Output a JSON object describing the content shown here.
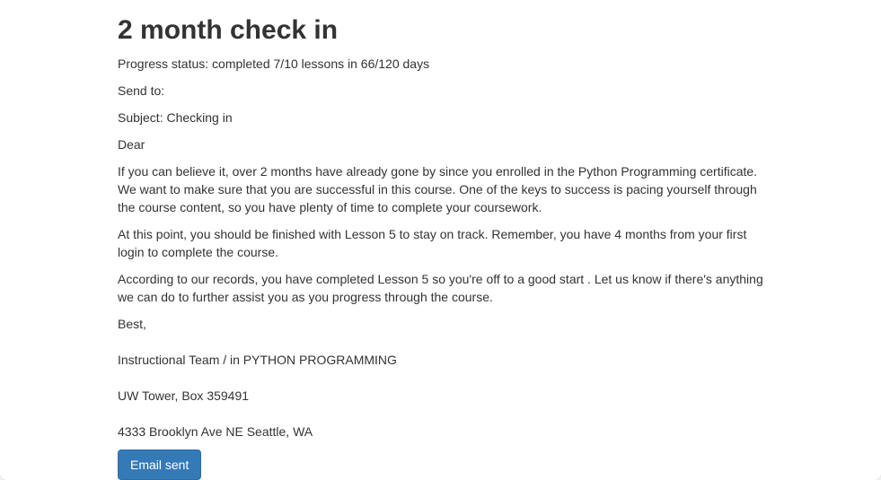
{
  "title": "2 month check in",
  "progress_status": "Progress status: completed 7/10 lessons in 66/120 days",
  "send_to": "Send to:",
  "subject": "Subject: Checking in",
  "greeting": "Dear",
  "paragraphs": [
    "If you can believe it, over 2 months have already gone by since you enrolled in the Python Programming certificate. We want to make sure that you are successful in this course. One of the keys to success is pacing yourself through the course content, so you have plenty of time to complete your coursework.",
    "At this point, you should be finished with Lesson 5 to stay on track. Remember, you have 4 months from your first login to complete the course.",
    "According to our records, you have completed Lesson 5 so you're off to a good start . Let us know if there's anything we can do to further assist you as you progress through the course."
  ],
  "signoff": "Best,",
  "signature": {
    "team": "Instructional Team / in PYTHON PROGRAMMING",
    "address_line1": "UW Tower, Box 359491",
    "address_line2": "4333 Brooklyn Ave NE Seattle, WA"
  },
  "button_label": "Email sent",
  "colors": {
    "button": "#337ab7",
    "text": "#333333"
  }
}
